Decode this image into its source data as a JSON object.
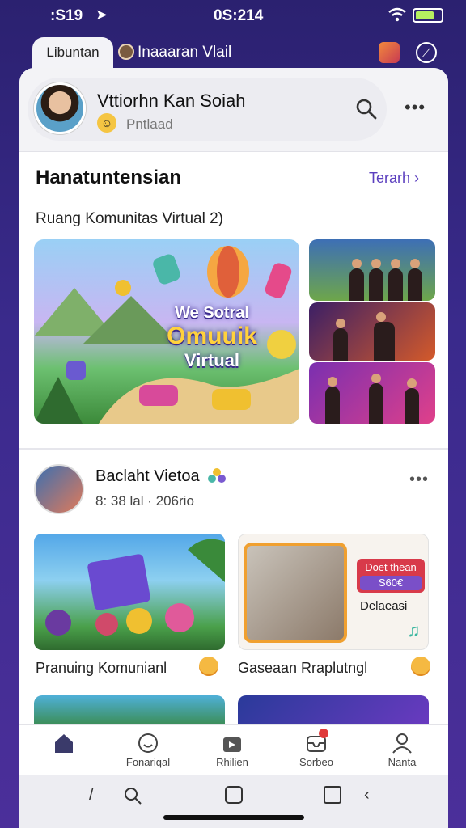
{
  "status": {
    "left": ":S19",
    "time": "0S:214"
  },
  "top": {
    "tab_label": "Libuntan",
    "title": "Inaaaran Vlail"
  },
  "profile": {
    "name": "Vttiorhn Kan Soiah",
    "subtitle": "Pntlaad"
  },
  "section": {
    "title": "Hanatuntensian",
    "link": "Terarh ›",
    "subtitle": "Ruang Komunitas Virtual 2)"
  },
  "hero": {
    "line1": "We Sotral",
    "line2": "Omuuik",
    "line3": "Virtual"
  },
  "post": {
    "name": "Baclaht Vietoa",
    "meta": "8: 38 lal · 206rio"
  },
  "cards": [
    {
      "label": "Pranuing Komunianl"
    },
    {
      "label": "Gaseaan Rraplutngl",
      "badge_line1": "Doet thean",
      "badge_line2": "S60€",
      "text": "Delaeasi"
    }
  ],
  "tabs": [
    {
      "label": ""
    },
    {
      "label": "Fonariqal"
    },
    {
      "label": "Rhilien"
    },
    {
      "label": "Sorbeo"
    },
    {
      "label": "Nanta"
    }
  ],
  "colors": {
    "accent": "#5b3fbf",
    "background": "#3a2a8c"
  }
}
